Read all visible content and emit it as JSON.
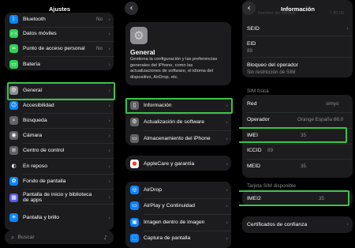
{
  "panel1": {
    "title": "Ajustes",
    "rows": [
      {
        "label": "Bluetooth",
        "value": "No",
        "icon": "bluetooth-icon",
        "color": "#0a84ff",
        "glyph": "ᛒ"
      },
      {
        "label": "Datos móviles",
        "value": "",
        "icon": "antenna-icon",
        "color": "#30d158",
        "glyph": "((·))"
      },
      {
        "label": "Punto de acceso personal",
        "value": "No",
        "icon": "link-icon",
        "color": "#30d158",
        "glyph": "∞"
      },
      {
        "label": "Batería",
        "value": "",
        "icon": "battery-icon",
        "color": "#30d158",
        "glyph": "▭"
      },
      {
        "label": "General",
        "value": "",
        "icon": "gear-icon",
        "color": "#8e8e93",
        "glyph": "⚙"
      },
      {
        "label": "Accesibilidad",
        "value": "",
        "icon": "accessibility-icon",
        "color": "#0a84ff",
        "glyph": "☺"
      },
      {
        "label": "Búsqueda",
        "value": "",
        "icon": "search-icon",
        "color": "#636366",
        "glyph": "⌕"
      },
      {
        "label": "Cámara",
        "value": "",
        "icon": "camera-icon",
        "color": "#636366",
        "glyph": "◉"
      },
      {
        "label": "Centro de control",
        "value": "",
        "icon": "toggles-icon",
        "color": "#636366",
        "glyph": "≡"
      },
      {
        "label": "En reposo",
        "value": "",
        "icon": "standby-icon",
        "color": "#1c1c1e",
        "glyph": "◐"
      },
      {
        "label": "Fondo de pantalla",
        "value": "",
        "icon": "wallpaper-icon",
        "color": "#0a84ff",
        "glyph": "✿"
      },
      {
        "label": "Pantalla de inicio y biblioteca",
        "label2": "de apps",
        "value": "",
        "icon": "home-screen-icon",
        "color": "#5e5ce6",
        "glyph": "▦"
      },
      {
        "label": "Pantalla y brillo",
        "value": "",
        "icon": "brightness-icon",
        "color": "#0a84ff",
        "glyph": "☀"
      }
    ],
    "search_placeholder": "Buscar"
  },
  "panel2": {
    "hero_title": "General",
    "hero_desc": [
      "Gestiona la configuración y las preferencias",
      "generales del iPhone, como las",
      "actualizaciones de software, el idioma del",
      "dispositivo, AirDrop, etc."
    ],
    "group1": [
      {
        "label": "Información",
        "icon": "phone-icon",
        "glyph": "▯"
      },
      {
        "label": "Actualización de software",
        "icon": "gear-icon",
        "glyph": "⚙"
      },
      {
        "label": "Almacenamiento del iPhone",
        "icon": "storage-icon",
        "glyph": "▭"
      }
    ],
    "group2": [
      {
        "label": "AppleCare y garantía",
        "icon": "apple-icon",
        "glyph": "●"
      }
    ],
    "group3": [
      {
        "label": "AirDrop",
        "icon": "airdrop-icon",
        "glyph": "◎"
      },
      {
        "label": "AirPlay y Continuidad",
        "icon": "airplay-icon",
        "glyph": "▭"
      },
      {
        "label": "Imagen dentro de imagen",
        "icon": "pip-icon",
        "glyph": "▣"
      },
      {
        "label": "Captura de pantalla",
        "icon": "screenshot-icon",
        "glyph": "⬚"
      }
    ]
  },
  "panel3": {
    "title": "Información",
    "faded_label": "Nombre del modelo",
    "faded_value": "7.80.00",
    "seid_label": "SEID",
    "eid_label": "EID",
    "eid_value": "89",
    "carrier_label": "Bloqueo del operador",
    "carrier_value": "Sin restricción de SIM",
    "sim_section": "SIM física",
    "sim_rows": [
      {
        "label": "Red",
        "value": "simyo"
      },
      {
        "label": "Operador",
        "value": "Orange España 66.0"
      },
      {
        "label": "IMEI",
        "value": "35"
      },
      {
        "label": "ICCID",
        "value": "89"
      },
      {
        "label": "MEID",
        "value": "35"
      }
    ],
    "available_section": "Tarjeta SIM disponible",
    "imei2_label": "IMEI2",
    "imei2_value": "35",
    "cert_label": "Certificados de confianza"
  },
  "colors": {
    "highlight": "#3cc24a",
    "card": "#1c1c1e"
  }
}
